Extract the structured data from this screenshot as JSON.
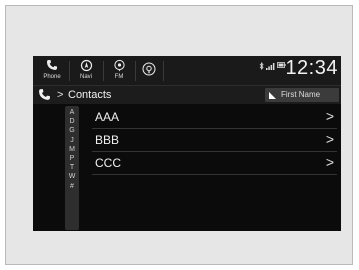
{
  "topbar": {
    "buttons": [
      {
        "label": "Phone",
        "icon": "phone-icon"
      },
      {
        "label": "Navi",
        "icon": "navi-icon"
      },
      {
        "label": "FM",
        "icon": "fm-radio-icon"
      },
      {
        "label": "",
        "icon": "carplay-icon"
      }
    ],
    "status_icons": [
      "bluetooth-icon",
      "signal-icon",
      "battery-icon"
    ],
    "clock": "12:34"
  },
  "header": {
    "breadcrumb_chevron": ">",
    "title": "Contacts",
    "sort_label": "First Name"
  },
  "alphabet": [
    "A",
    "D",
    "G",
    "J",
    "M",
    "P",
    "T",
    "W",
    "#"
  ],
  "contacts": [
    {
      "name": "AAA"
    },
    {
      "name": "BBB"
    },
    {
      "name": "CCC"
    }
  ],
  "row_chevron": ">",
  "colors": {
    "screen_bg": "#0b0b0b",
    "topbar_bg": "#1a1a1a",
    "sort_button_bg": "#3b3b3b",
    "text": "#f0f0f0"
  }
}
